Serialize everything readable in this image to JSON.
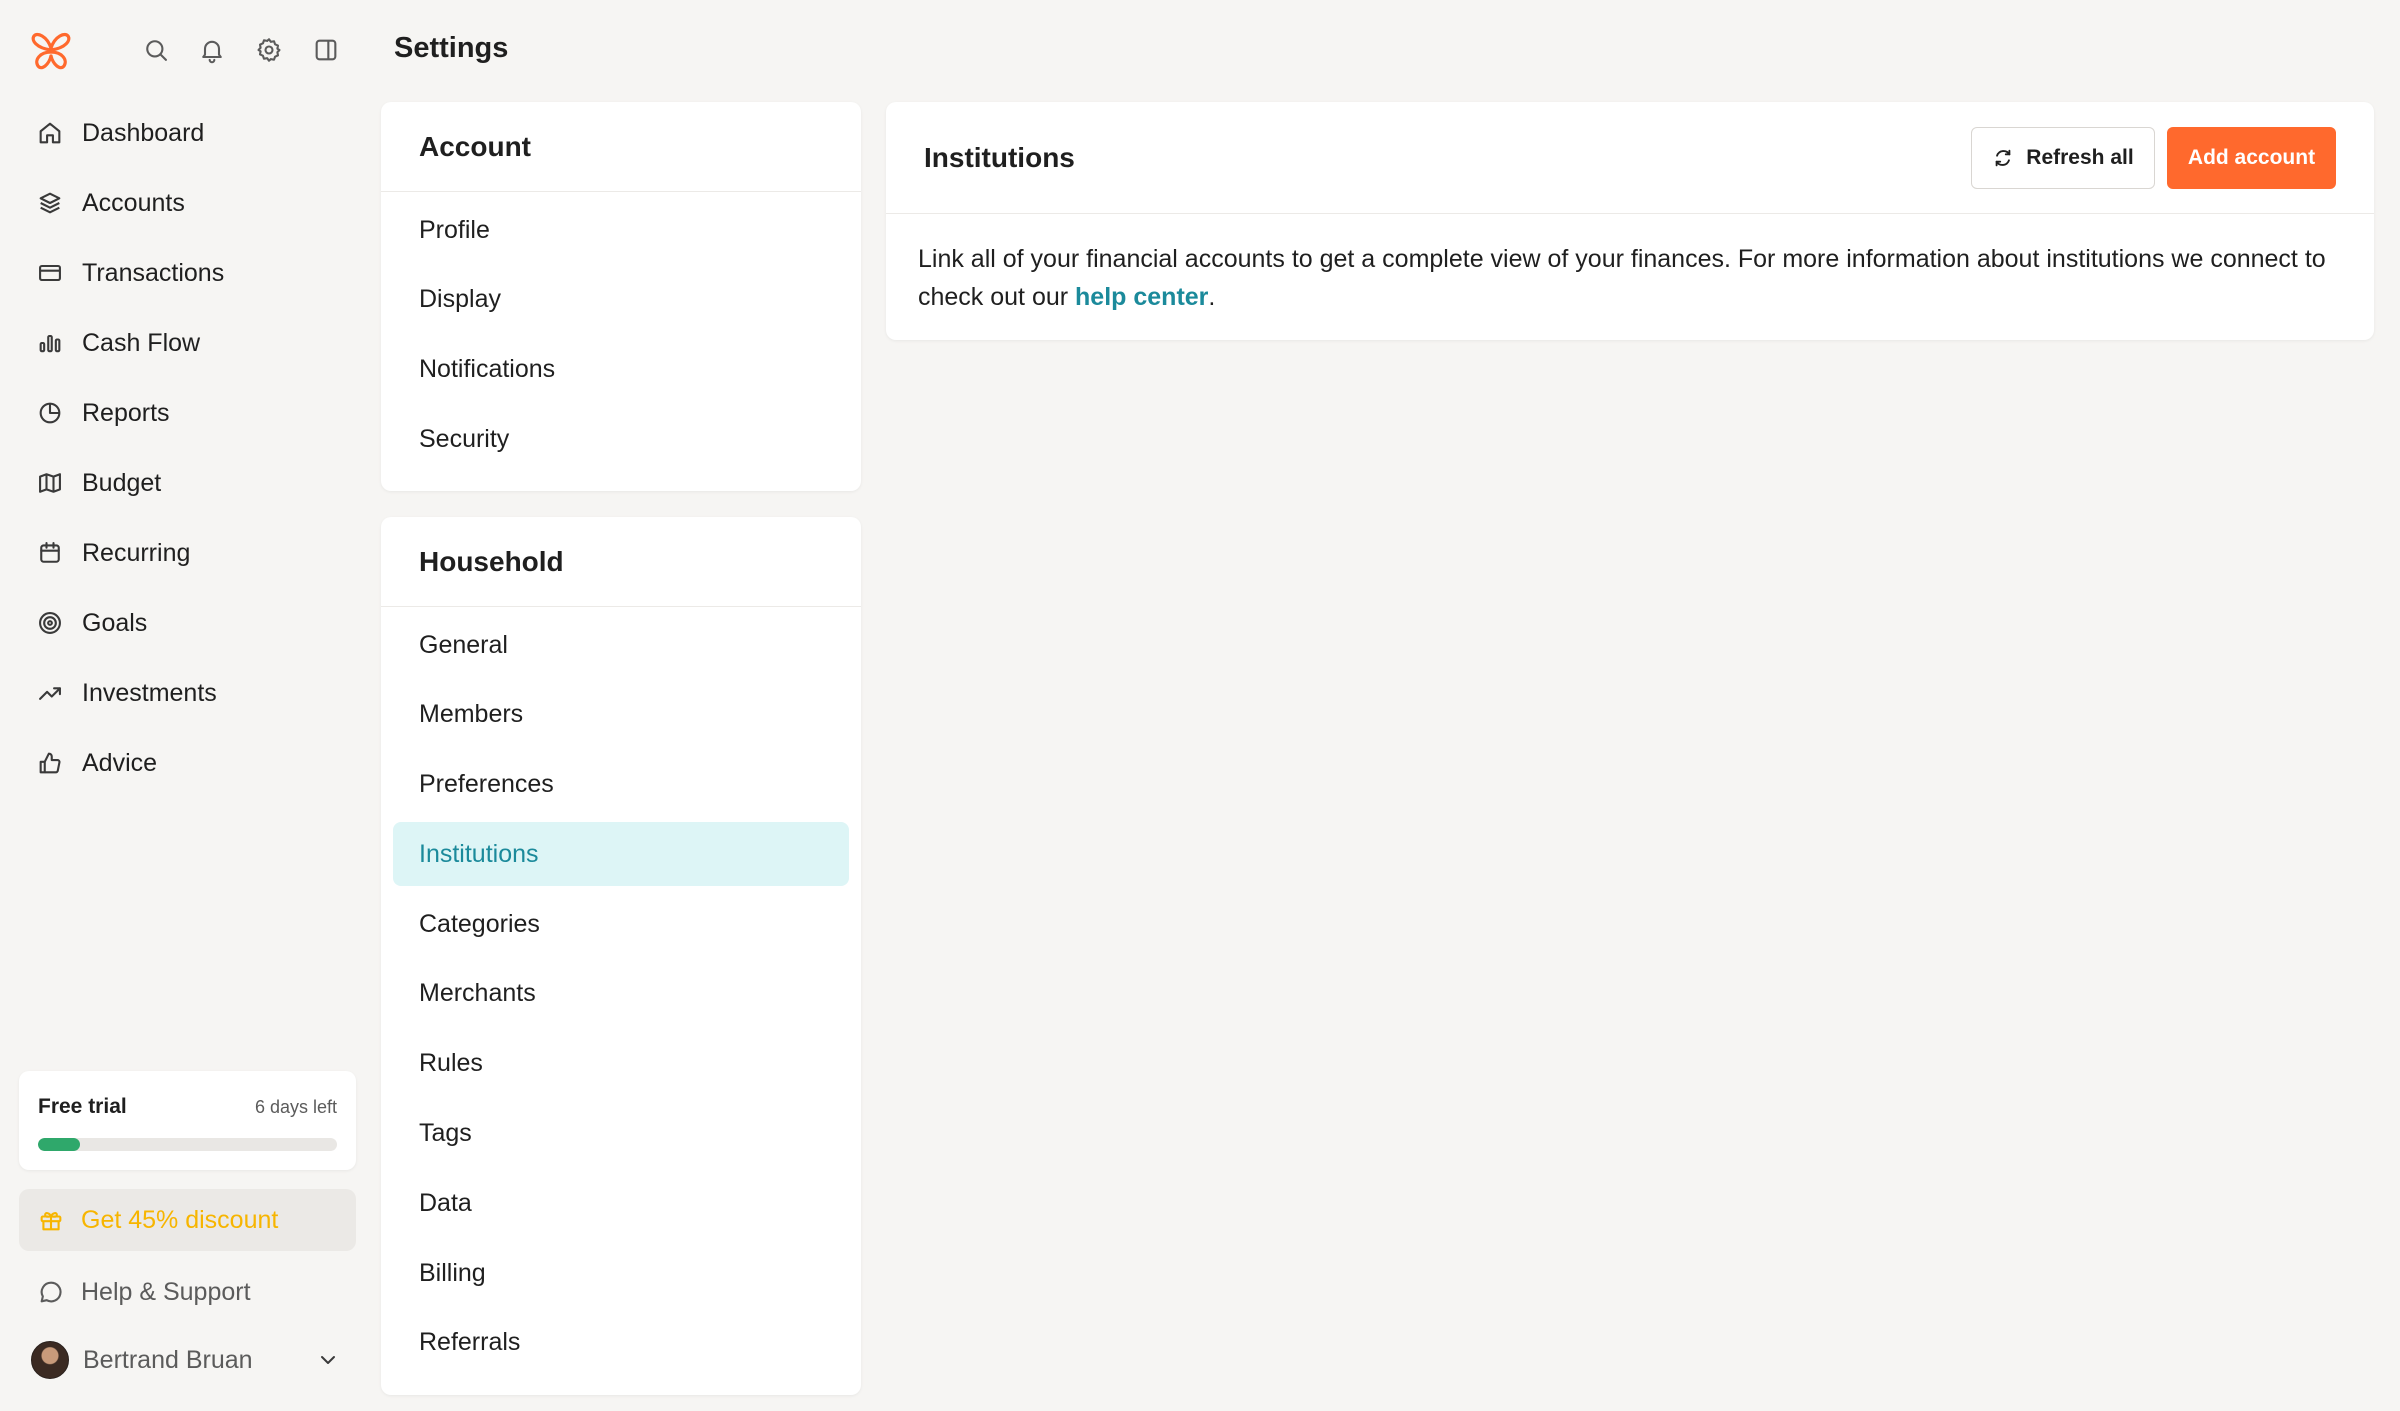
{
  "page": {
    "title": "Settings"
  },
  "nav": {
    "items": [
      {
        "label": "Dashboard",
        "icon": "home-icon"
      },
      {
        "label": "Accounts",
        "icon": "layers-icon"
      },
      {
        "label": "Transactions",
        "icon": "credit-card-icon"
      },
      {
        "label": "Cash Flow",
        "icon": "bar-chart-icon"
      },
      {
        "label": "Reports",
        "icon": "pie-chart-icon"
      },
      {
        "label": "Budget",
        "icon": "map-icon"
      },
      {
        "label": "Recurring",
        "icon": "calendar-icon"
      },
      {
        "label": "Goals",
        "icon": "target-icon"
      },
      {
        "label": "Investments",
        "icon": "trending-up-icon"
      },
      {
        "label": "Advice",
        "icon": "thumbs-up-icon"
      }
    ]
  },
  "trial": {
    "title": "Free trial",
    "days_left": "6 days left",
    "progress": 0.14,
    "color": "#2fa86b"
  },
  "discount": {
    "label": "Get 45% discount",
    "color": "#f7b500"
  },
  "help": {
    "label": "Help & Support"
  },
  "user": {
    "name": "Bertrand Bruan"
  },
  "account_menu": {
    "title": "Account",
    "items": [
      "Profile",
      "Display",
      "Notifications",
      "Security"
    ]
  },
  "household_menu": {
    "title": "Household",
    "items": [
      "General",
      "Members",
      "Preferences",
      "Institutions",
      "Categories",
      "Merchants",
      "Rules",
      "Tags",
      "Data",
      "Billing",
      "Referrals"
    ],
    "active": "Institutions"
  },
  "institutions": {
    "title": "Institutions",
    "refresh_label": "Refresh all",
    "add_label": "Add account",
    "description": "Link all of your financial accounts to get a complete view of your finances. For more information about institutions we connect to check out our ",
    "link_text": "help center",
    "suffix": "."
  },
  "colors": {
    "accent": "#ff692d",
    "link": "#1b8a9b",
    "active_bg": "#ddf5f6"
  }
}
